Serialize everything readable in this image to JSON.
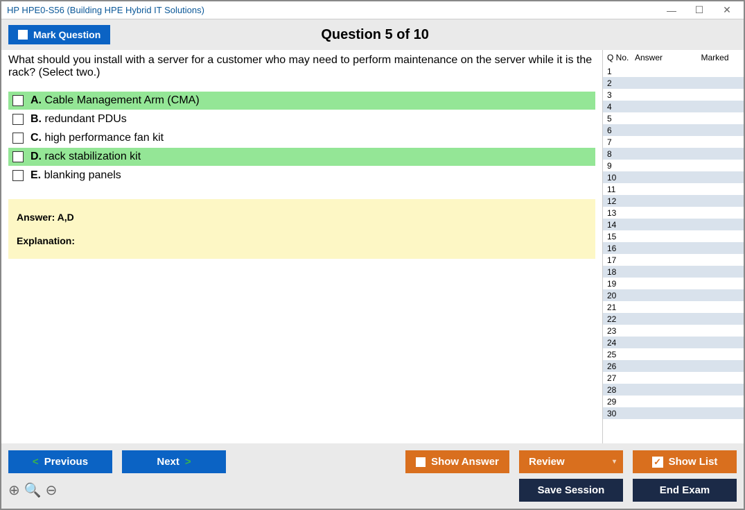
{
  "window": {
    "title": "HP HPE0-S56 (Building HPE Hybrid IT Solutions)"
  },
  "header": {
    "mark_label": "Mark Question",
    "question_title": "Question 5 of 10"
  },
  "question": {
    "text": "What should you install with a server for a customer who may need to perform maintenance on the server while it is the rack? (Select two.)",
    "options": [
      {
        "letter": "A.",
        "text": "Cable Management Arm (CMA)",
        "correct": true
      },
      {
        "letter": "B.",
        "text": "redundant PDUs",
        "correct": false
      },
      {
        "letter": "C.",
        "text": "high performance fan kit",
        "correct": false
      },
      {
        "letter": "D.",
        "text": "rack stabilization kit",
        "correct": true
      },
      {
        "letter": "E.",
        "text": "blanking panels",
        "correct": false
      }
    ],
    "answer_label": "Answer: A,D",
    "explanation_label": "Explanation:"
  },
  "sidebar": {
    "headers": {
      "qno": "Q No.",
      "answer": "Answer",
      "marked": "Marked"
    },
    "count": 30
  },
  "footer": {
    "previous": "Previous",
    "next": "Next",
    "show_answer": "Show Answer",
    "review": "Review",
    "show_list": "Show List",
    "save_session": "Save Session",
    "end_exam": "End Exam"
  }
}
